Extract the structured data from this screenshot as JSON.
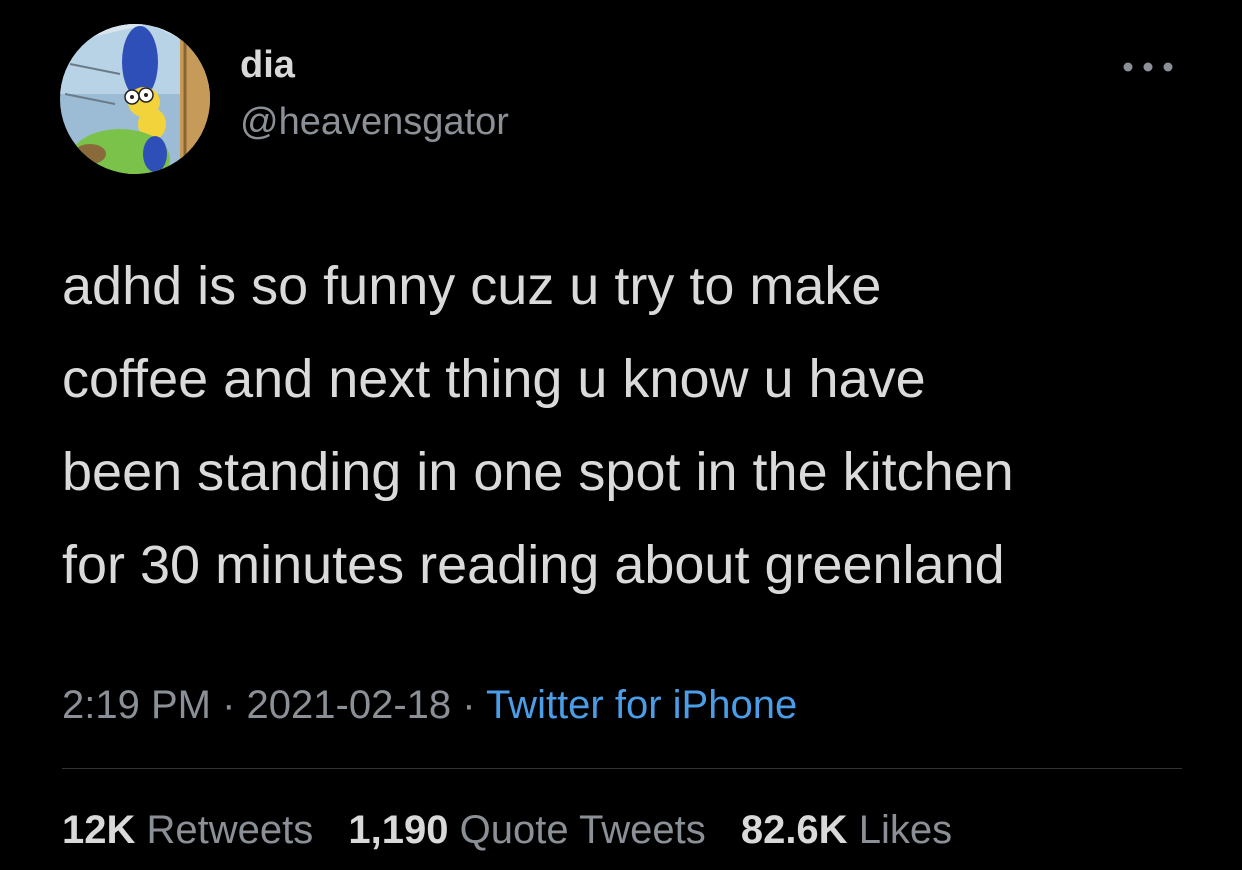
{
  "author": {
    "display_name": "dia",
    "handle": "@heavensgator",
    "avatar_icon": "cartoon-avatar-icon"
  },
  "tweet": {
    "text_lines": [
      "adhd is so funny cuz u try to make",
      "coffee and next thing u know u have",
      "been standing in one spot in the kitchen",
      "for 30 minutes reading about greenland"
    ],
    "time": "2:19 PM",
    "separator": " · ",
    "date": "2021-02-18",
    "source": "Twitter for iPhone"
  },
  "stats": {
    "retweets": {
      "count": "12K",
      "label": "Retweets"
    },
    "quotes": {
      "count": "1,190",
      "label": "Quote Tweets"
    },
    "likes": {
      "count": "82.6K",
      "label": "Likes"
    }
  },
  "colors": {
    "background": "#000000",
    "text": "#d9d9d9",
    "secondary": "#8b9096",
    "link": "#4a9de6",
    "divider": "#2f3336"
  }
}
